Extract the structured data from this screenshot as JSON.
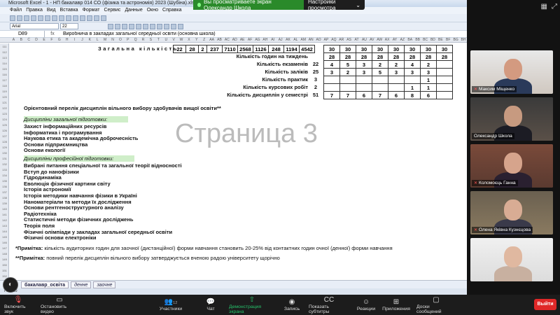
{
  "banner": {
    "sharing_text": "Вы просматриваете экран Олександр Школа",
    "view_options": "Настройки просмотра"
  },
  "excel": {
    "title": "Microsoft Excel - 1 - НП бакалавр 014 СО (фізика та астрономія) 2023 (Шубіна).xlsx  [Только для чтения]",
    "menu": [
      "Файл",
      "Правка",
      "Вид",
      "Вставка",
      "Формат",
      "Сервис",
      "Данные",
      "Окно",
      "Справка"
    ],
    "font_name": "Arial",
    "font_size": "22",
    "name_box": "D89",
    "formula": "Виробнича в закладах загальної середньої освіти (основна школа)",
    "col_letters": [
      "A",
      "B",
      "C",
      "D",
      "E",
      "F",
      "G",
      "H",
      "I",
      "J",
      "K",
      "L",
      "M",
      "N",
      "O",
      "P",
      "Q",
      "R",
      "S",
      "T",
      "U",
      "V",
      "W",
      "X",
      "Y",
      "Z",
      "AA",
      "AB",
      "AC",
      "AD",
      "AE",
      "AF",
      "AG",
      "AH",
      "AI",
      "AJ",
      "AK",
      "AL",
      "AM",
      "AN",
      "AO",
      "AP",
      "AQ",
      "AR",
      "AS",
      "AT",
      "AU",
      "AV",
      "AW",
      "AX",
      "AY",
      "AZ",
      "BA",
      "BB",
      "BC",
      "BD",
      "BE",
      "BF",
      "BG",
      "BH"
    ],
    "total_label": "Загальна кількість",
    "total_values": [
      "22",
      "28",
      "2",
      "237",
      "7110",
      "2568",
      "1126",
      "248",
      "1194",
      "4542"
    ],
    "total_semester": [
      "30",
      "30",
      "30",
      "30",
      "30",
      "30",
      "30",
      "30"
    ],
    "summary_rows": [
      {
        "label": "Кількість годин на тиждень",
        "total": "",
        "sem": [
          "28",
          "28",
          "28",
          "28",
          "28",
          "28",
          "28",
          "28"
        ]
      },
      {
        "label": "Кількість   екзаменів",
        "total": "22",
        "sem": [
          "4",
          "5",
          "3",
          "2",
          "2",
          "4",
          "2",
          ""
        ]
      },
      {
        "label": "Кількість   заліків",
        "total": "25",
        "sem": [
          "3",
          "2",
          "3",
          "5",
          "3",
          "3",
          "3",
          ""
        ]
      },
      {
        "label": "Кількість   практик",
        "total": "3",
        "sem": [
          "",
          "",
          "",
          "",
          "",
          "",
          "1",
          ""
        ]
      },
      {
        "label": "Кількість курсових робіт",
        "total": "2",
        "sem": [
          "",
          "",
          "",
          "",
          "",
          "1",
          "1",
          ""
        ]
      },
      {
        "label": "Кількість дисциплін у семестрі",
        "total": "51",
        "sem": [
          "7",
          "7",
          "6",
          "7",
          "6",
          "8",
          "6",
          ""
        ]
      }
    ],
    "watermark": "Страница 3",
    "list_title": "Орієнтовний перелік дисциплін вільного вибору здобувачів вищої освіти**",
    "cat_general": "Дисципліни загальної підготовки:",
    "general": [
      "Захист інформаційних ресурсів",
      "Інформатика і програмування",
      "Наукова етика та академічна доброчесність",
      "Основи підприємництва",
      "Основи екології"
    ],
    "cat_professional": "Дисципліни професійної підготовки:",
    "professional": [
      "Вибрані питання спеціальної та загальної теорії відносності",
      "Вступ до нанофізики",
      "Гідродинаміка",
      "Еволюція фізичної картини світу",
      "Історія астрономії",
      "Історія методики навчання фізики в Україні",
      "Наноматеріали та методи їх дослідження",
      "Основи рентгеноструктурного аналізу",
      "Радіотехніка",
      "Статистичні методи фізичних досліджень",
      "Теорія поля",
      "Фізичні олімпіади у закладах загальної середньої освіти",
      "Фізичні основи електроніки"
    ],
    "note1": "*Примітка: кількість аудиторних годин для заочної (дистанційної) форми навчання становить 20-25% від контактних годин очної (денної) форми навчання",
    "note2": "**Примітка: повний перелік дисциплін вільного вибору затверджується вченою радою університету щорічно",
    "tabs": [
      "бакалавр_освіта",
      "денне",
      "заочне"
    ],
    "status": "Готово"
  },
  "participants": [
    {
      "name": "Максим Міщенко",
      "muted": true
    },
    {
      "name": "Олександр Школа",
      "muted": false
    },
    {
      "name": "Коломоєць Ганна",
      "muted": true
    },
    {
      "name": "Олена Яківна Кузнєцова",
      "muted": true
    },
    {
      "name": "",
      "muted": false
    }
  ],
  "controls": {
    "unmute": "Включить звук",
    "video": "Остановить видео",
    "participants": "Участники",
    "participants_count": "12",
    "chat": "Чат",
    "share": "Демонстрация экрана",
    "record": "Запись",
    "captions": "Показать субтитры",
    "reactions": "Реакции",
    "apps": "Приложения",
    "whiteboards": "Доски сообщений",
    "leave": "Выйти"
  }
}
